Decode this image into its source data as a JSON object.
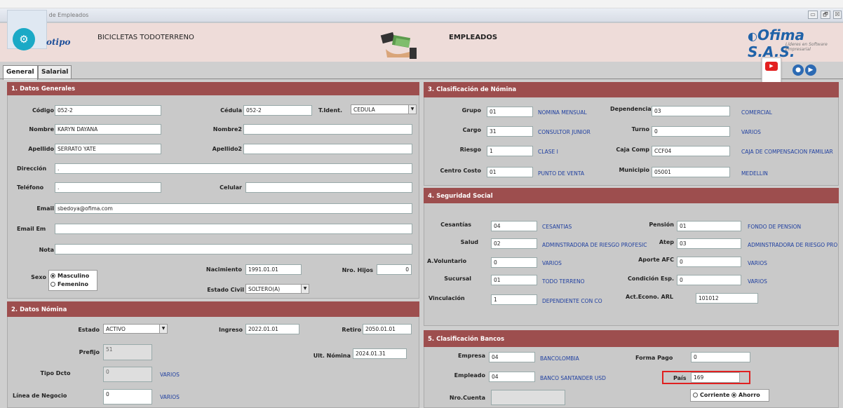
{
  "window": {
    "title": "n de Empleados",
    "buttons": [
      "▭",
      "🗗",
      "☒"
    ]
  },
  "header": {
    "logo_word": "otipo",
    "company": "BICICLETAS TODOTERRENO",
    "section_title": "EMPLEADOS",
    "brand": "Ofima S.A.S.",
    "brand_sub": "Líderes en Software Empresarial"
  },
  "tabs": {
    "general": "General",
    "salarial": "Salarial"
  },
  "datos_generales": {
    "heading": "1. Datos Generales",
    "codigo_label": "Código",
    "codigo": "052-2",
    "cedula_label": "Cédula",
    "cedula": "052-2",
    "tident_label": "T.Ident.",
    "tident": "CEDULA",
    "nombre_label": "Nombre",
    "nombre": "KARYN DAYANA",
    "nombre2_label": "Nombre2",
    "nombre2": "",
    "apellido_label": "Apellido",
    "apellido": "SERRATO YATE",
    "apellido2_label": "Apellido2",
    "apellido2": "",
    "direccion_label": "Dirección",
    "direccion": ".",
    "telefono_label": "Teléfono",
    "telefono": ".",
    "celular_label": "Celular",
    "celular": "",
    "email_label": "Email",
    "email": "sbedoya@ofima.com",
    "email_em_label": "Email Em",
    "email_em": "",
    "nota_label": "Nota",
    "nota": "",
    "sexo_label": "Sexo",
    "sexo_masculino": "Masculino",
    "sexo_femenino": "Femenino",
    "nacimiento_label": "Nacimiento",
    "nacimiento": "1991.01.01",
    "hijos_label": "Nro. Hijos",
    "hijos": "0",
    "estado_civil_label": "Estado Civil",
    "estado_civil": "SOLTERO(A)"
  },
  "datos_nomina": {
    "heading": "2. Datos Nómina",
    "estado_label": "Estado",
    "estado": "ACTIVO",
    "ingreso_label": "Ingreso",
    "ingreso": "2022.01.01",
    "retiro_label": "Retiro",
    "retiro": "2050.01.01",
    "prefijo_label": "Prefijo",
    "prefijo": "51",
    "ult_nomina_label": "Ult. Nómina",
    "ult_nomina": "2024.01.31",
    "tipo_dcto_label": "Tipo Dcto",
    "tipo_dcto": "0",
    "tipo_dcto_desc": "VARIOS",
    "linea_label": "Línea de Negocio",
    "linea": "0",
    "linea_desc": "VARIOS"
  },
  "clasificacion_nomina": {
    "heading": "3. Clasificación de Nómina",
    "grupo_label": "Grupo",
    "grupo": "01",
    "grupo_desc": "NOMINA MENSUAL",
    "dependencia_label": "Dependencia",
    "dependencia": "03",
    "dependencia_desc": "COMERCIAL",
    "cargo_label": "Cargo",
    "cargo": "31",
    "cargo_desc": "CONSULTOR JUNIOR",
    "turno_label": "Turno",
    "turno": "0",
    "turno_desc": "VARIOS",
    "riesgo_label": "Riesgo",
    "riesgo": "1",
    "riesgo_desc": "CLASE I",
    "caja_label": "Caja Comp",
    "caja": "CCF04",
    "caja_desc": "CAJA DE COMPENSACION FAMILIAR",
    "centro_label": "Centro Costo",
    "centro": "01",
    "centro_desc": "PUNTO DE VENTA",
    "municipio_label": "Municipio",
    "municipio": "05001",
    "municipio_desc": "MEDELLIN"
  },
  "seguridad_social": {
    "heading": "4. Seguridad Social",
    "cesantias_label": "Cesantías",
    "cesantias": "04",
    "cesantias_desc": "CESANTIAS",
    "pension_label": "Pensión",
    "pension": "01",
    "pension_desc": "FONDO DE PENSION",
    "salud_label": "Salud",
    "salud": "02",
    "salud_desc": "ADMINSTRADORA DE RIESGO PROFESIC",
    "atep_label": "Atep",
    "atep": "03",
    "atep_desc": "ADMINSTRADORA DE RIESGO PRO",
    "voluntario_label": "A.Voluntario",
    "voluntario": "0",
    "voluntario_desc": "VARIOS",
    "afc_label": "Aporte AFC",
    "afc": "0",
    "afc_desc": "VARIOS",
    "sucursal_label": "Sucursal",
    "sucursal": "01",
    "sucursal_desc": "TODO TERRENO",
    "condicion_label": "Condición Esp.",
    "condicion": "0",
    "condicion_desc": "VARIOS",
    "vinculacion_label": "Vinculación",
    "vinculacion": "1",
    "vinculacion_desc": "DEPENDIENTE CON CO",
    "arl_label": "Act.Econo. ARL",
    "arl": "101012"
  },
  "clasificacion_bancos": {
    "heading": "5. Clasificación Bancos",
    "empresa_label": "Empresa",
    "empresa": "04",
    "empresa_desc": "BANCOLOMBIA",
    "forma_pago_label": "Forma Pago",
    "forma_pago": "0",
    "empleado_label": "Empleado",
    "empleado": "04",
    "empleado_desc": "BANCO SANTANDER USD",
    "pais_label": "País",
    "pais": "169",
    "cuenta_label": "Nro.Cuenta",
    "cuenta": "",
    "corriente": "Corriente",
    "ahorro": "Ahorro"
  }
}
